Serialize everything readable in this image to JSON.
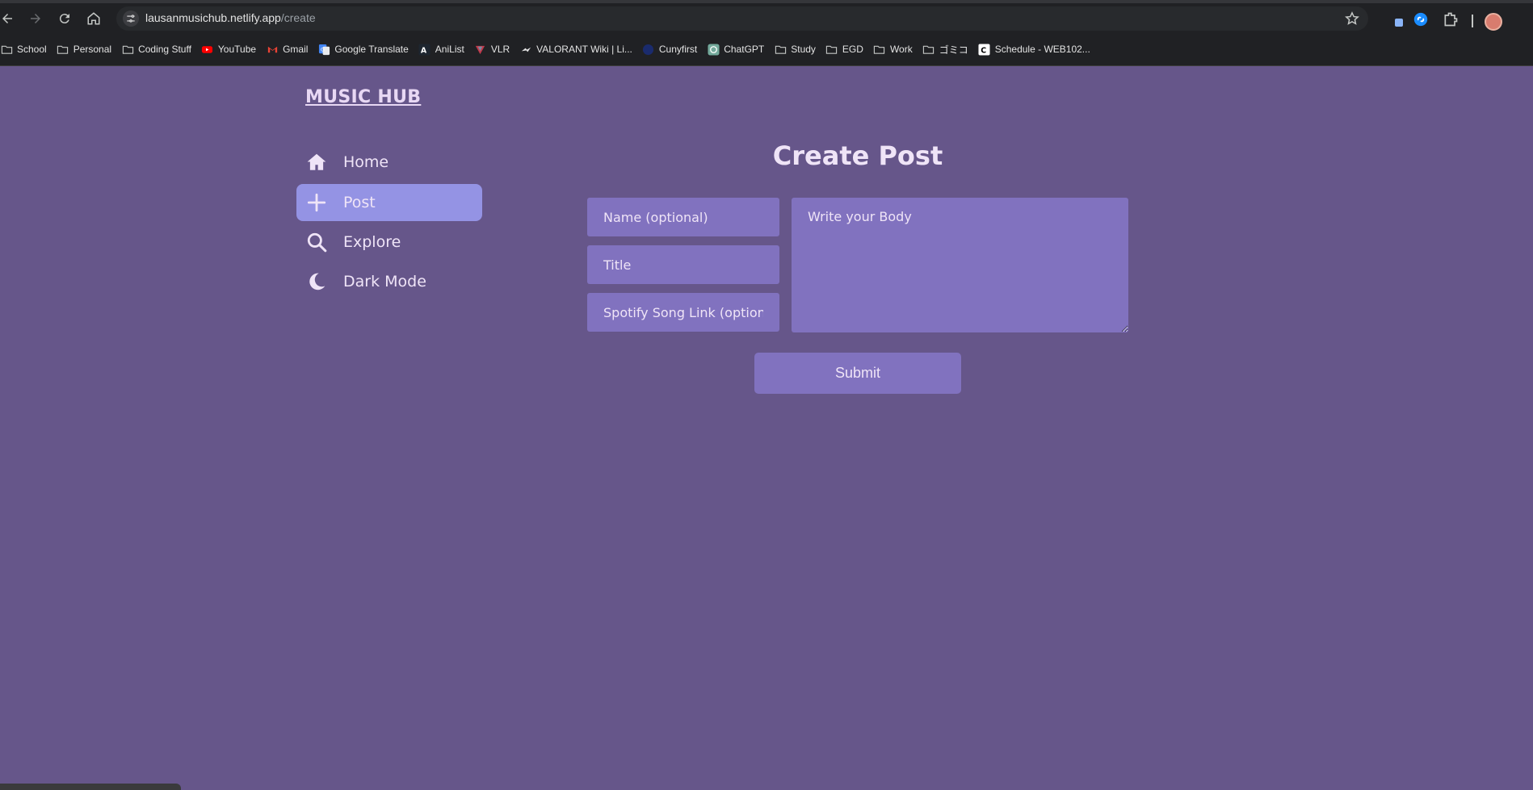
{
  "browser": {
    "url_host": "lausanmusichub.netlify.app",
    "url_path": "/create",
    "bookmarks": [
      {
        "label": "School",
        "icon": "folder-icon"
      },
      {
        "label": "Personal",
        "icon": "folder-icon"
      },
      {
        "label": "Coding Stuff",
        "icon": "folder-icon"
      },
      {
        "label": "YouTube",
        "icon": "youtube-icon"
      },
      {
        "label": "Gmail",
        "icon": "gmail-icon"
      },
      {
        "label": "Google Translate",
        "icon": "google-translate-icon"
      },
      {
        "label": "AniList",
        "icon": "anilist-icon"
      },
      {
        "label": "VLR",
        "icon": "vlr-icon"
      },
      {
        "label": "VALORANT Wiki | Li...",
        "icon": "valorant-wiki-icon"
      },
      {
        "label": "Cunyfirst",
        "icon": "cunyfirst-icon"
      },
      {
        "label": "ChatGPT",
        "icon": "chatgpt-icon"
      },
      {
        "label": "Study",
        "icon": "folder-icon"
      },
      {
        "label": "EGD",
        "icon": "folder-icon"
      },
      {
        "label": "Work",
        "icon": "folder-icon"
      },
      {
        "label": "ゴミコ",
        "icon": "folder-icon"
      },
      {
        "label": "Schedule - WEB102...",
        "icon": "schedule-icon"
      }
    ]
  },
  "app": {
    "logo": "MUSIC HUB",
    "nav": [
      {
        "label": "Home",
        "icon": "home-icon",
        "active": false
      },
      {
        "label": "Post",
        "icon": "plus-icon",
        "active": true
      },
      {
        "label": "Explore",
        "icon": "search-icon",
        "active": false
      },
      {
        "label": "Dark Mode",
        "icon": "moon-icon",
        "active": false
      }
    ],
    "page_title": "Create Post",
    "form": {
      "name_placeholder": "Name (optional)",
      "title_placeholder": "Title",
      "spotify_placeholder": "Spotify Song Link (optional)",
      "body_placeholder": "Write your Body",
      "submit_label": "Submit"
    }
  },
  "colors": {
    "background": "#66568a",
    "field": "#8172bf",
    "active_nav": "#9493e4",
    "text": "#efe4f7"
  }
}
